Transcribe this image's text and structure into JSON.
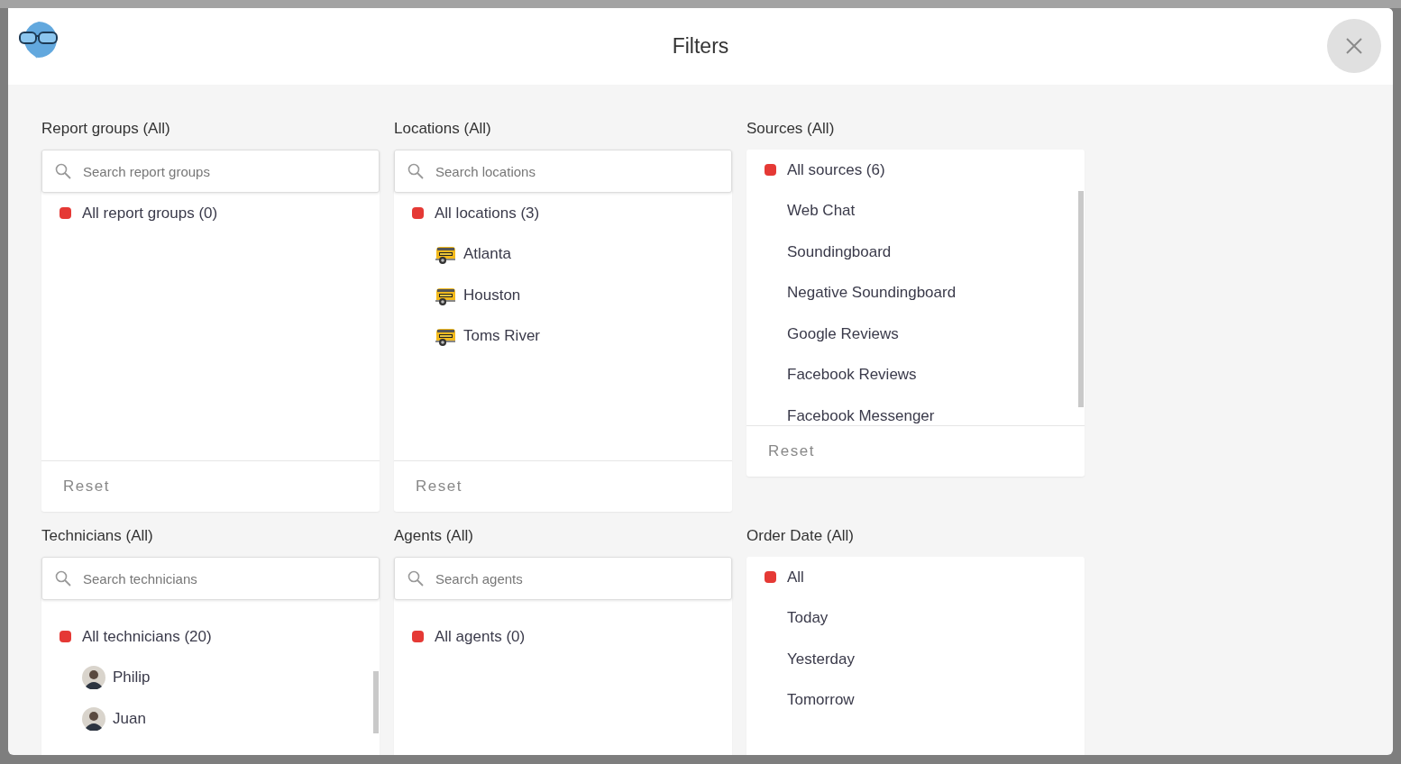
{
  "dialog": {
    "title": "Filters"
  },
  "filters": [
    {
      "title": "Report groups (All)",
      "search": {
        "placeholder": "Search report groups"
      },
      "options": [
        {
          "label": "All report groups (0)",
          "selected": true,
          "kind": "plain"
        }
      ],
      "reset": "Reset"
    },
    {
      "title": "Locations (All)",
      "search": {
        "placeholder": "Search locations"
      },
      "options": [
        {
          "label": "All locations (3)",
          "selected": true,
          "kind": "plain"
        },
        {
          "label": "Atlanta",
          "selected": false,
          "kind": "location"
        },
        {
          "label": "Houston",
          "selected": false,
          "kind": "location"
        },
        {
          "label": "Toms River",
          "selected": false,
          "kind": "location"
        }
      ],
      "reset": "Reset"
    },
    {
      "title": "Sources (All)",
      "scrollable": true,
      "options": [
        {
          "label": "All sources (6)",
          "selected": true,
          "kind": "plain"
        },
        {
          "label": "Web Chat",
          "selected": false,
          "kind": "plain"
        },
        {
          "label": "Soundingboard",
          "selected": false,
          "kind": "plain"
        },
        {
          "label": "Negative Soundingboard",
          "selected": false,
          "kind": "plain"
        },
        {
          "label": "Google Reviews",
          "selected": false,
          "kind": "plain"
        },
        {
          "label": "Facebook Reviews",
          "selected": false,
          "kind": "plain"
        },
        {
          "label": "Facebook Messenger",
          "selected": false,
          "kind": "plain"
        }
      ],
      "reset": "Reset"
    },
    {
      "title": "Technicians (All)",
      "search": {
        "placeholder": "Search technicians"
      },
      "scrollable": true,
      "options": [
        {
          "label": "All technicians (20)",
          "selected": true,
          "kind": "plain"
        },
        {
          "label": "Philip",
          "selected": false,
          "kind": "person"
        },
        {
          "label": "Juan",
          "selected": false,
          "kind": "person"
        }
      ]
    },
    {
      "title": "Agents (All)",
      "search": {
        "placeholder": "Search agents"
      },
      "options": [
        {
          "label": "All agents (0)",
          "selected": true,
          "kind": "plain"
        }
      ]
    },
    {
      "title": "Order Date (All)",
      "options": [
        {
          "label": "All",
          "selected": true,
          "kind": "plain"
        },
        {
          "label": "Today",
          "selected": false,
          "kind": "plain"
        },
        {
          "label": "Yesterday",
          "selected": false,
          "kind": "plain"
        },
        {
          "label": "Tomorrow",
          "selected": false,
          "kind": "plain"
        }
      ]
    }
  ]
}
